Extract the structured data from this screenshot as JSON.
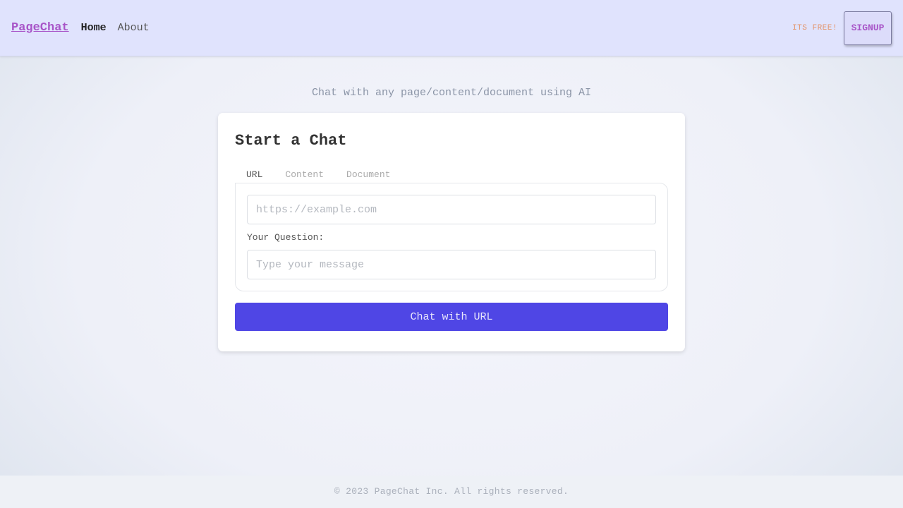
{
  "nav": {
    "brand": "PageChat",
    "links": [
      {
        "label": "Home",
        "active": true
      },
      {
        "label": "About",
        "active": false
      }
    ],
    "promo": "ITS FREE!",
    "signup_label": "SIGNUP"
  },
  "hero": {
    "tagline": "Chat with any page/content/document using AI"
  },
  "card": {
    "title": "Start a Chat",
    "tabs": [
      {
        "label": "URL",
        "active": true
      },
      {
        "label": "Content",
        "active": false
      },
      {
        "label": "Document",
        "active": false
      }
    ],
    "url_input": {
      "value": "",
      "placeholder": "https://example.com"
    },
    "question_label": "Your Question:",
    "question_input": {
      "value": "",
      "placeholder": "Type your message"
    },
    "submit_label": "Chat with URL"
  },
  "footer": {
    "text": "© 2023 PageChat Inc. All rights reserved."
  },
  "colors": {
    "brand": "#a855c8",
    "primary_button": "#4f46e5",
    "navbar_bg": "#e0e3fd",
    "promo": "#e3946a"
  }
}
